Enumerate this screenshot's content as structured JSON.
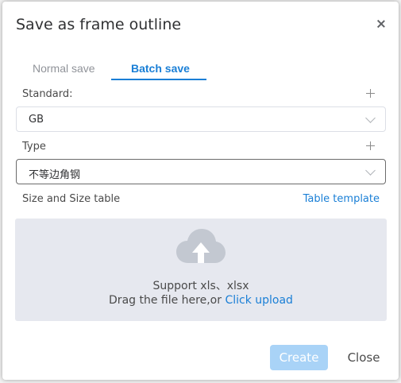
{
  "dialog": {
    "title": "Save as frame outline"
  },
  "tabs": [
    {
      "label": "Normal save",
      "active": false
    },
    {
      "label": "Batch save",
      "active": true
    }
  ],
  "standard": {
    "label": "Standard:",
    "value": "GB"
  },
  "type": {
    "label": "Type",
    "value": "不等边角钢"
  },
  "size": {
    "label": "Size and Size table",
    "template_link": "Table template"
  },
  "upload": {
    "support_text": "Support xls、xlsx",
    "drag_text": "Drag the file here,or ",
    "click_text": "Click upload"
  },
  "footer": {
    "create_label": "Create",
    "close_label": "Close"
  },
  "colors": {
    "accent": "#1a7fd6",
    "create_disabled": "#a9d3f7",
    "upload_bg": "#e6e8ef",
    "cloud": "#c3c8d1"
  },
  "icons": {
    "close": "close-icon",
    "plus": "plus-icon",
    "chevron": "chevron-down-icon",
    "cloud": "cloud-upload-icon"
  }
}
